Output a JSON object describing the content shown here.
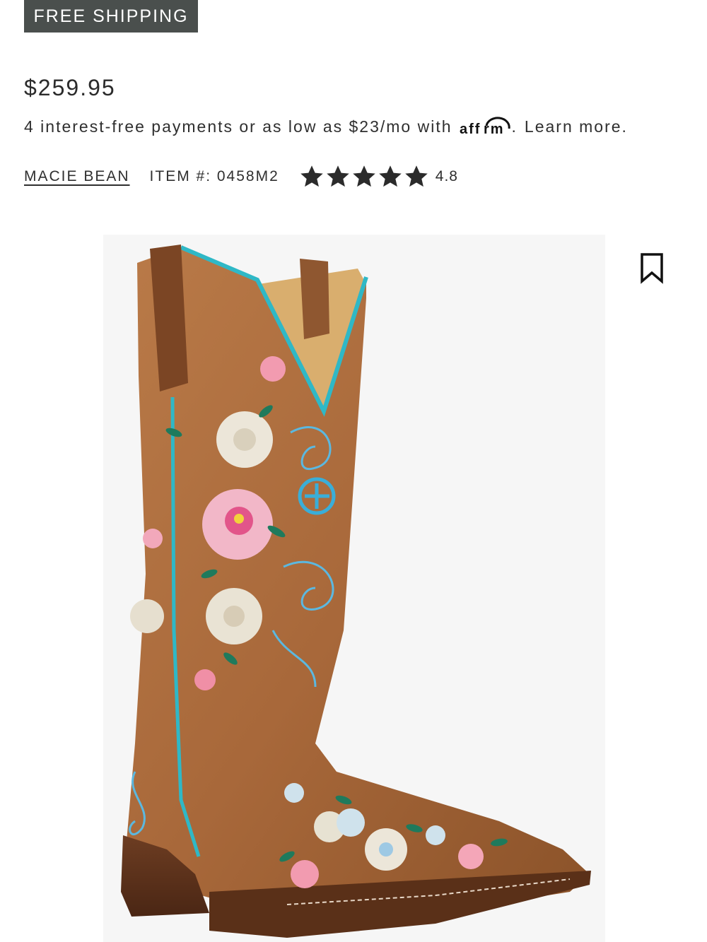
{
  "badge": {
    "label": "FREE SHIPPING"
  },
  "product": {
    "price": "$259.95",
    "financing": {
      "prefix": "4 interest-free payments or as low as $23/mo with",
      "provider_logo": "affirm",
      "suffix": ".",
      "learn_more": "Learn more."
    },
    "brand": "MACIE BEAN",
    "item_number": "ITEM #: 0458M2",
    "rating": {
      "value": "4.8",
      "stars": 5
    }
  },
  "image": {
    "subject": "boot-image",
    "alt": "Macie Bean floral embroidered western boot"
  },
  "icons": {
    "bookmark": "bookmark-icon",
    "star": "star-icon",
    "affirm": "affirm-logo"
  },
  "colors": {
    "badge_bg": "#4a4f4d",
    "text": "#2b2b2b",
    "star": "#2b2b2b",
    "leather": "#a8683a",
    "turquoise": "#2fb8c6"
  }
}
